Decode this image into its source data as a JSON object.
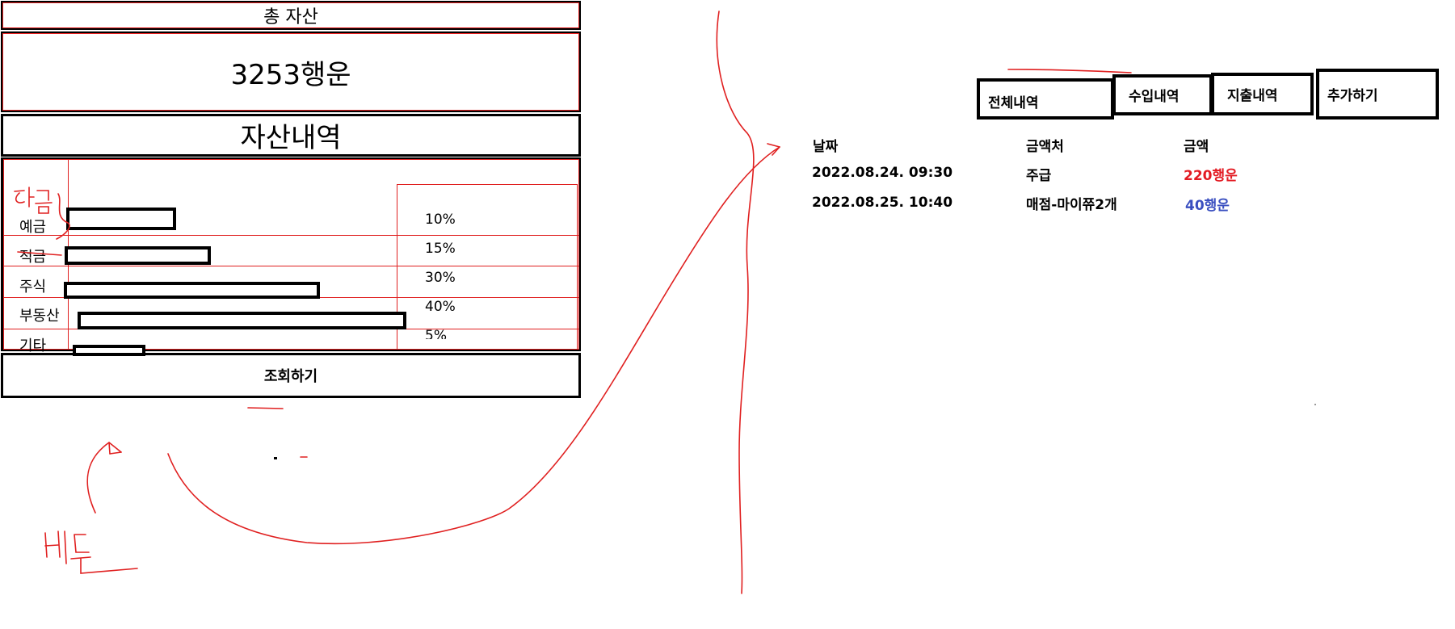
{
  "summary": {
    "title": "총 자산",
    "total": "3253행운",
    "section_title": "자산내역",
    "query_button": "조회하기"
  },
  "assets": [
    {
      "label": "예금",
      "percent_text": "10%",
      "share": 10
    },
    {
      "label": "적금",
      "percent_text": "15%",
      "share": 15
    },
    {
      "label": "주식",
      "percent_text": "30%",
      "share": 30
    },
    {
      "label": "부동산",
      "percent_text": "40%",
      "share": 40
    },
    {
      "label": "기타",
      "percent_text": "5%",
      "share": 5
    }
  ],
  "history": {
    "tabs": [
      "전체내역",
      "수입내역",
      "지출내역",
      "추가하기"
    ],
    "columns": [
      "날짜",
      "금액처",
      "금액"
    ],
    "rows": [
      {
        "date": "2022.08.24. 09:30",
        "source": "주급",
        "amount": "220행운",
        "type": "income"
      },
      {
        "date": "2022.08.25. 10:40",
        "source": "매점-마이쮸2개",
        "amount": "40행운",
        "type": "expense"
      }
    ]
  },
  "annotations": {
    "current_note": "현금",
    "button_note": "버튼"
  },
  "colors": {
    "annotation": "#e02020",
    "income": "#e31b23",
    "expense": "#3a4fc0"
  }
}
